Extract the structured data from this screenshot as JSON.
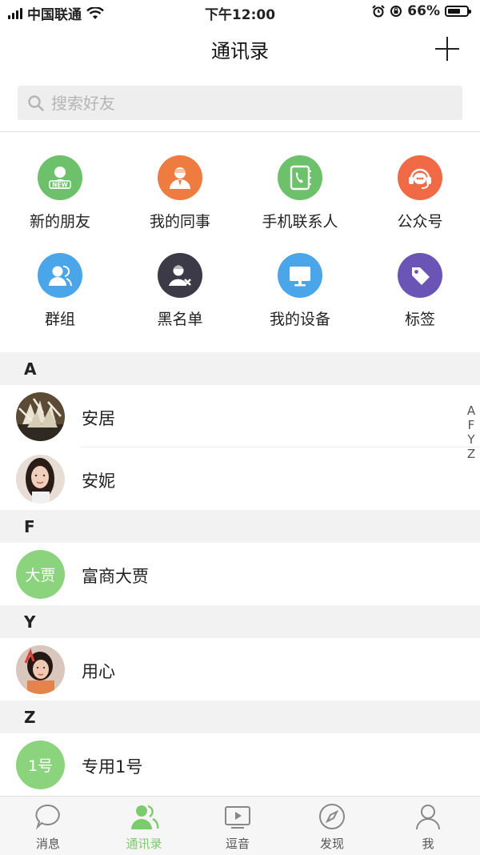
{
  "status_bar": {
    "carrier": "中国联通",
    "time": "下午12:00",
    "battery": "66%",
    "battery_level": 0.66
  },
  "navbar": {
    "title": "通讯录"
  },
  "search": {
    "placeholder": "搜索好友"
  },
  "shortcuts": [
    {
      "label": "新的朋友",
      "color": "#6cc16a",
      "icon": "new-friend-icon"
    },
    {
      "label": "我的同事",
      "color": "#ee7b3f",
      "icon": "colleague-icon"
    },
    {
      "label": "手机联系人",
      "color": "#6cc16a",
      "icon": "phone-contact-icon"
    },
    {
      "label": "公众号",
      "color": "#ef6a45",
      "icon": "official-account-icon"
    },
    {
      "label": "群组",
      "color": "#4aa6e8",
      "icon": "group-icon"
    },
    {
      "label": "黑名单",
      "color": "#3d3a48",
      "icon": "blacklist-icon"
    },
    {
      "label": "我的设备",
      "color": "#4aa6e8",
      "icon": "device-icon"
    },
    {
      "label": "标签",
      "color": "#6a55b6",
      "icon": "tag-icon"
    }
  ],
  "sections": [
    {
      "letter": "A",
      "contacts": [
        {
          "name": "安居",
          "avatar": "photo"
        },
        {
          "name": "安妮",
          "avatar": "photo"
        }
      ]
    },
    {
      "letter": "F",
      "contacts": [
        {
          "name": "富商大贾",
          "avatar_text": "大贾"
        }
      ]
    },
    {
      "letter": "Y",
      "contacts": [
        {
          "name": "用心",
          "avatar": "photo"
        }
      ]
    },
    {
      "letter": "Z",
      "contacts": [
        {
          "name": "专用1号",
          "avatar_text": "1号"
        }
      ]
    }
  ],
  "index_letters": [
    "A",
    "F",
    "Y",
    "Z"
  ],
  "tabs": [
    {
      "label": "消息",
      "icon": "message-icon",
      "active": false
    },
    {
      "label": "通讯录",
      "icon": "contacts-icon",
      "active": true
    },
    {
      "label": "逗音",
      "icon": "video-icon",
      "active": false
    },
    {
      "label": "发现",
      "icon": "compass-icon",
      "active": false
    },
    {
      "label": "我",
      "icon": "profile-icon",
      "active": false
    }
  ],
  "colors": {
    "accent": "#7ccb6c",
    "section_bg": "#f2f2f2",
    "search_bg": "#eeeeee"
  }
}
